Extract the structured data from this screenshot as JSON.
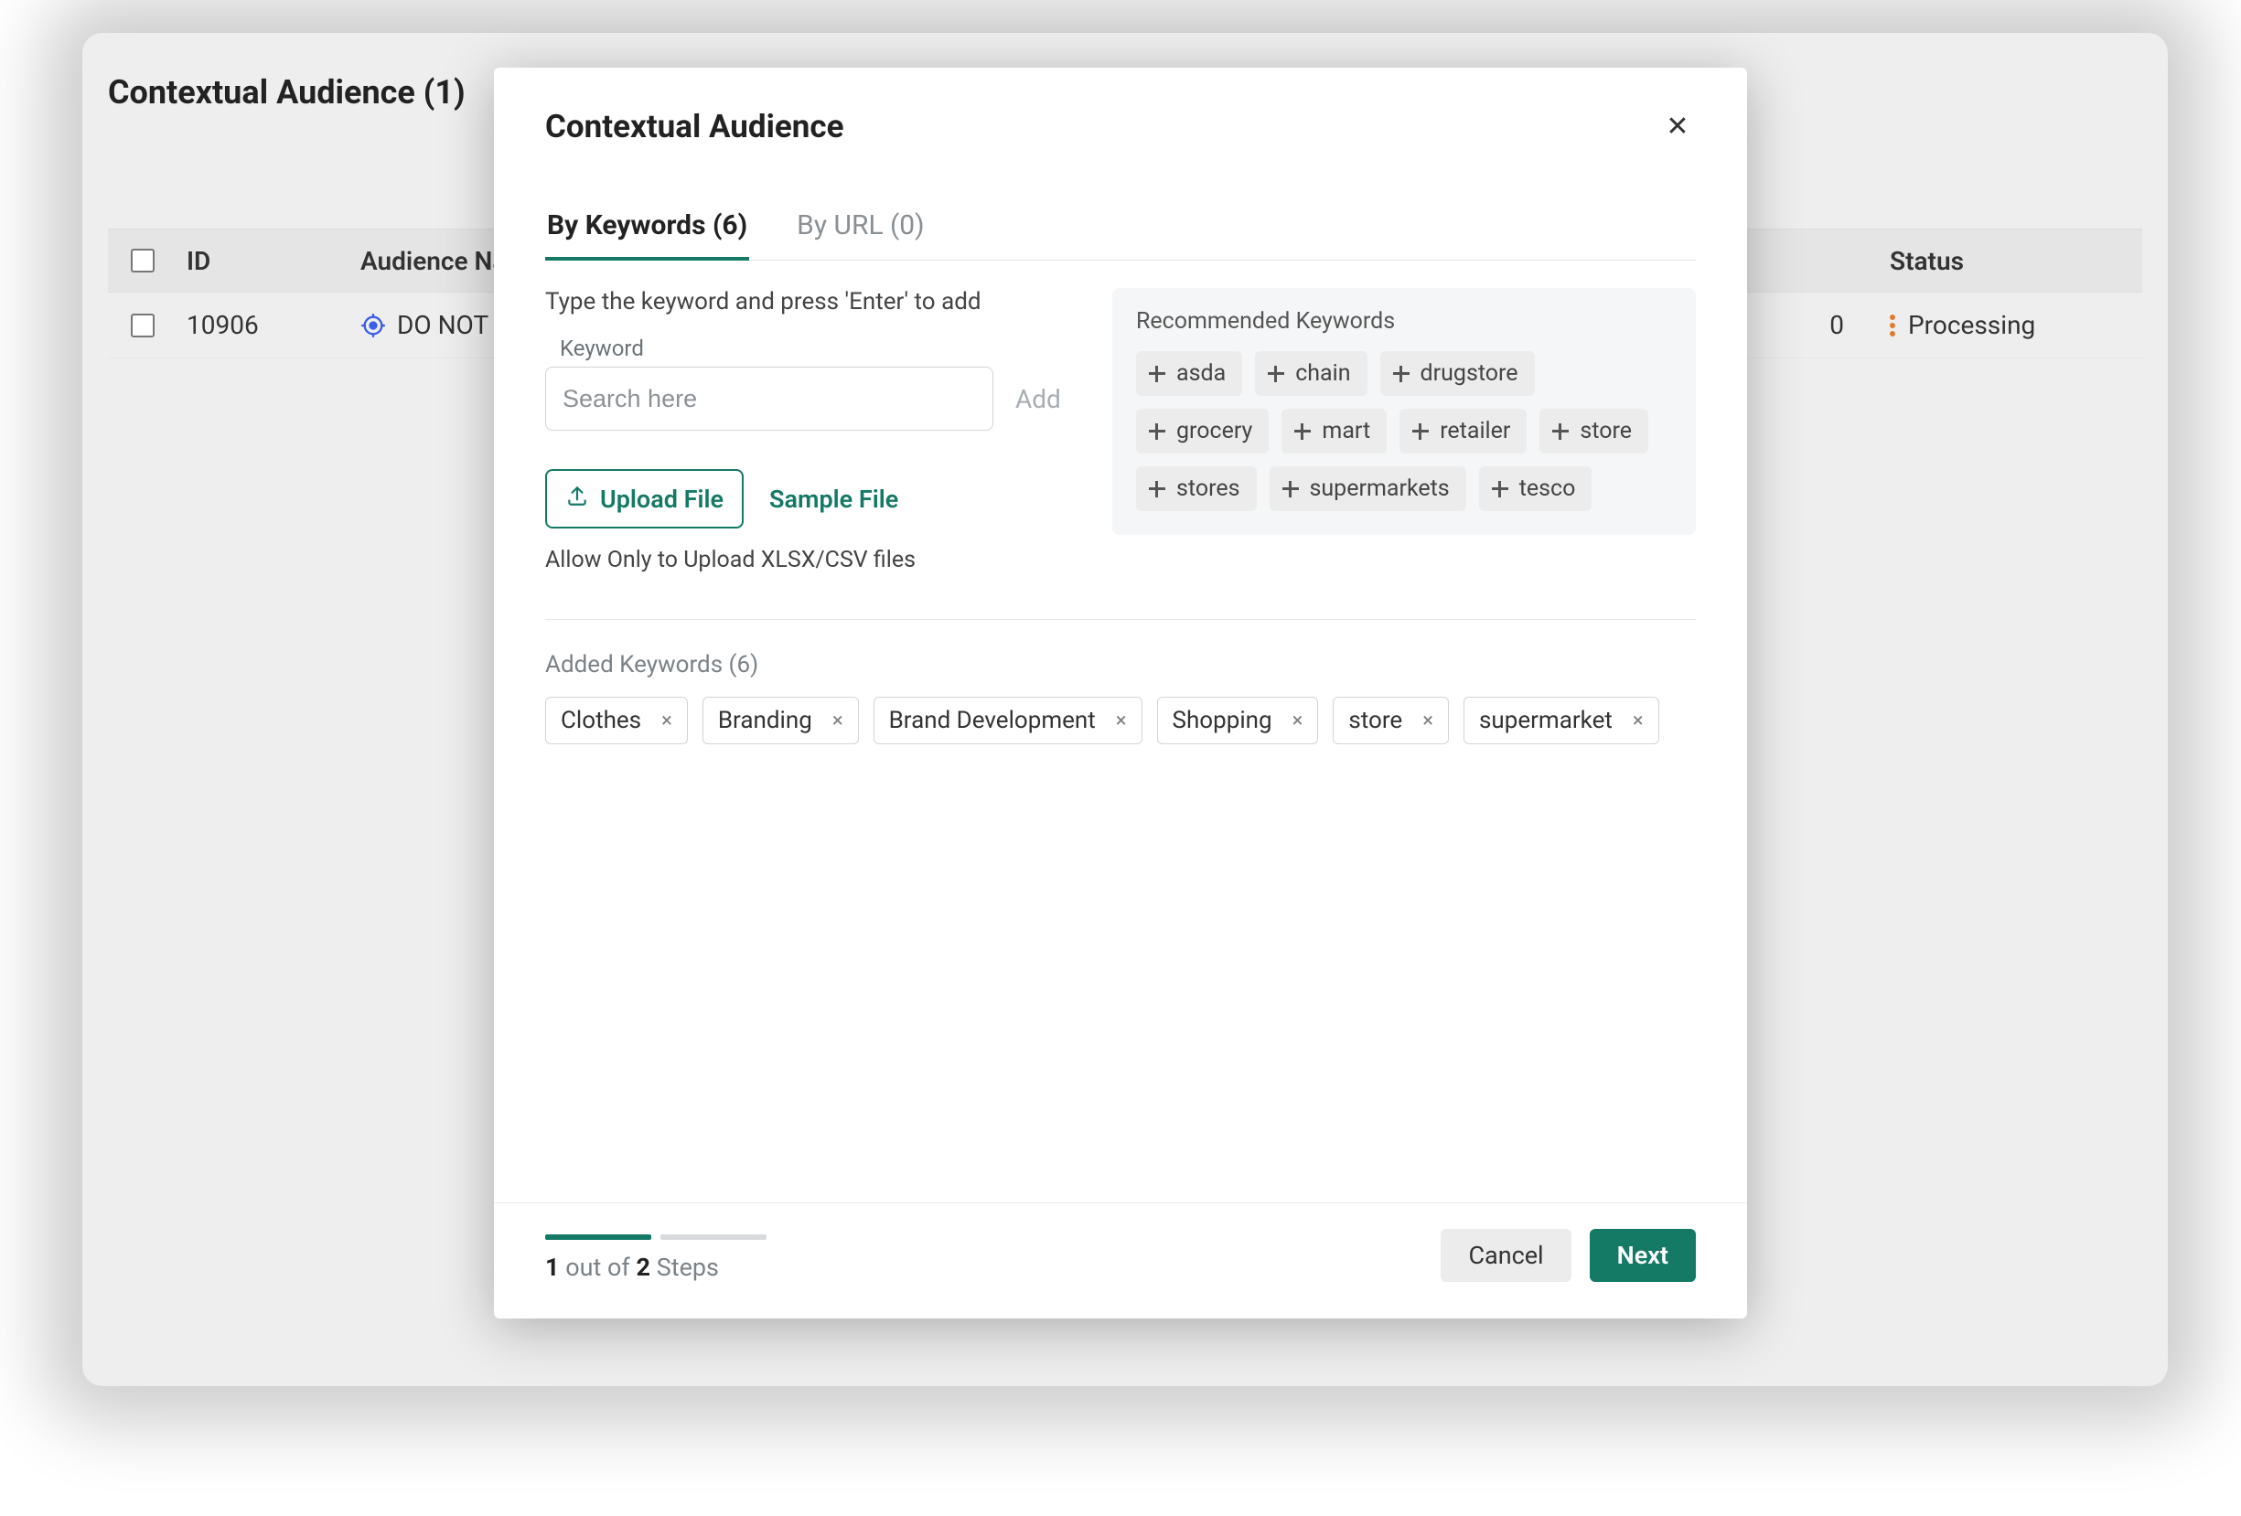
{
  "page": {
    "title": "Contextual Audience (1)"
  },
  "table": {
    "headers": {
      "id": "ID",
      "name": "Audience Nar",
      "status": "Status"
    },
    "rows": [
      {
        "id": "10906",
        "name": "DO NOT D",
        "count": "0",
        "status": "Processing"
      }
    ]
  },
  "modal": {
    "title": "Contextual Audience",
    "tabs": {
      "by_keywords": "By Keywords (6)",
      "by_url": "By URL (0)"
    },
    "instruction": "Type the keyword and press 'Enter' to add",
    "keyword_field": {
      "label": "Keyword",
      "placeholder": "Search here"
    },
    "add_label": "Add",
    "upload_label": "Upload File",
    "sample_label": "Sample File",
    "upload_hint": "Allow Only to Upload XLSX/CSV files",
    "recommended": {
      "title": "Recommended Keywords",
      "items": [
        "asda",
        "chain",
        "drugstore",
        "grocery",
        "mart",
        "retailer",
        "store",
        "stores",
        "supermarkets",
        "tesco"
      ]
    },
    "added": {
      "title": "Added Keywords (6)",
      "items": [
        "Clothes",
        "Branding",
        "Brand Development",
        "Shopping",
        "store",
        "supermarket"
      ]
    },
    "footer": {
      "step_current": "1",
      "step_total": "2",
      "step_word_outof": "out of",
      "step_word_steps": "Steps",
      "cancel": "Cancel",
      "next": "Next"
    }
  }
}
